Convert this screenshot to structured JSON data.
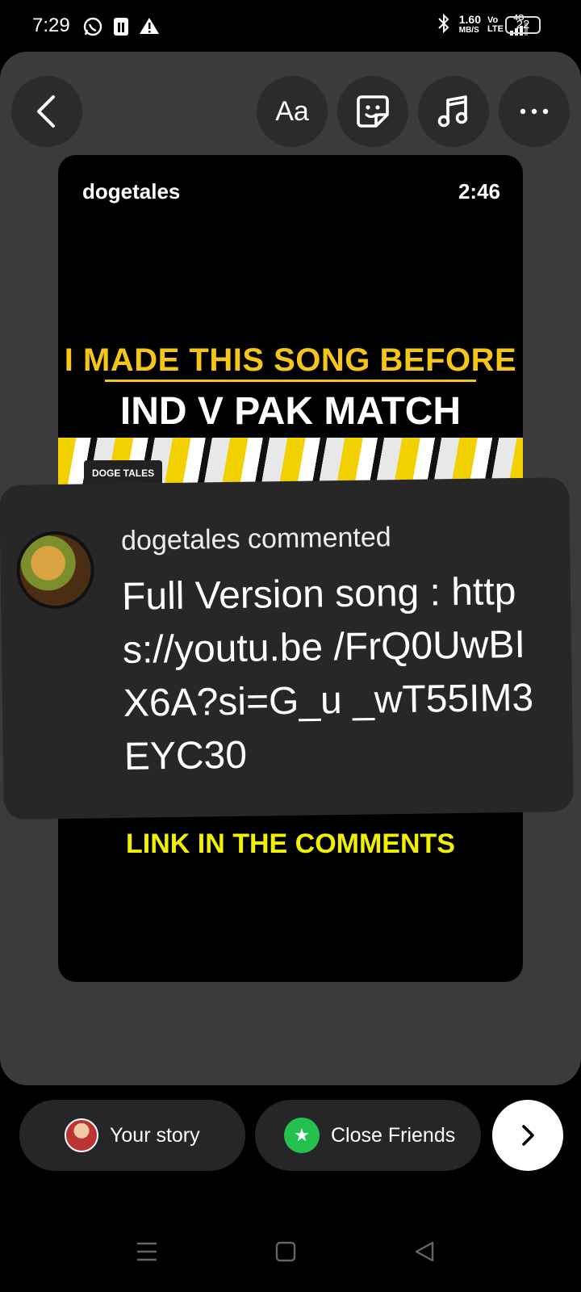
{
  "status_bar": {
    "time": "7:29",
    "net_speed": "1.60",
    "net_unit": "MB/S",
    "volte": "Vo LTE",
    "signal_label": "4G",
    "battery": "22"
  },
  "toolbar": {
    "text_tool_label": "Aa"
  },
  "story": {
    "username": "dogetales",
    "duration": "2:46",
    "headline_1": "I MADE THIS SONG BEFORE",
    "headline_2": "IND V PAK MATCH",
    "thumbnail_badge": "DOGE TALES",
    "comments_cta": "LINK IN THE COMMENTS"
  },
  "comment": {
    "header": "dogetales commented",
    "text": "Full Version song : https://youtu.be /FrQ0UwBIX6A?si=G_u _wT55IM3EYC30"
  },
  "share": {
    "your_story_label": "Your story",
    "close_friends_label": "Close Friends",
    "close_friends_color": "#25c14f"
  }
}
